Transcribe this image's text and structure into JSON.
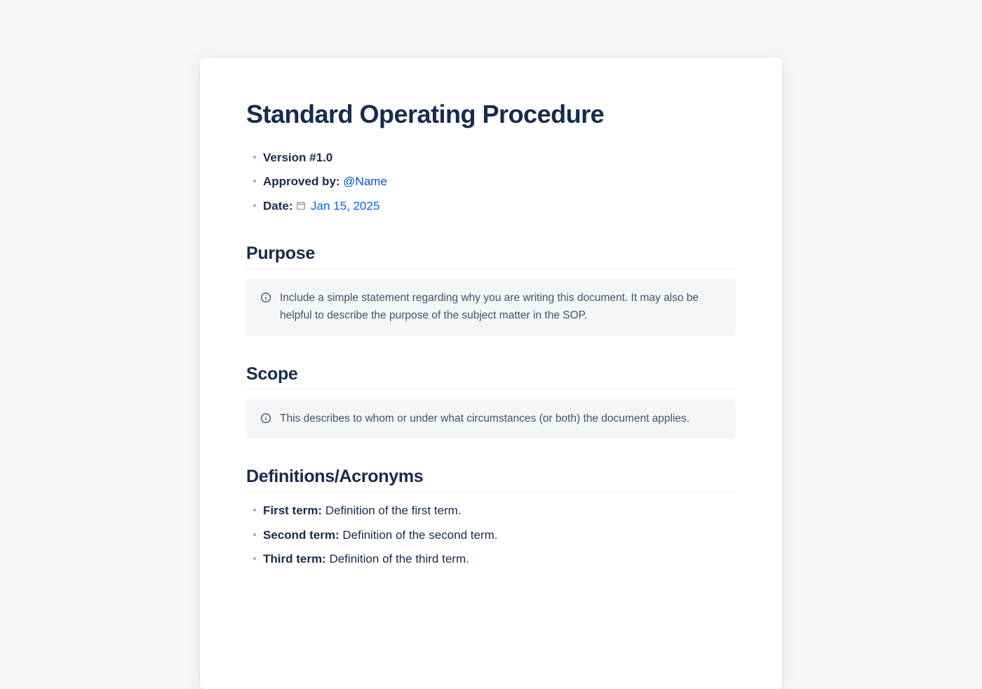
{
  "title": "Standard Operating Procedure",
  "meta": {
    "version_label": "Version #",
    "version_value": "1.0",
    "approved_label": "Approved by:",
    "approved_mention": "@Name",
    "date_label": "Date:",
    "date_value": "Jan 15, 2025"
  },
  "sections": {
    "purpose": {
      "heading": "Purpose",
      "panel": "Include a simple statement regarding why you are writing this document. It may also be helpful to describe the purpose of the subject matter in the SOP."
    },
    "scope": {
      "heading": "Scope",
      "panel": "This describes to whom or under what circumstances (or both) the document applies."
    },
    "definitions": {
      "heading": "Definitions/Acronyms",
      "items": [
        {
          "term": "First term:",
          "def": "Definition of the first term."
        },
        {
          "term": "Second term:",
          "def": "Definition of the second term."
        },
        {
          "term": "Third term:",
          "def": "Definition of the third term."
        }
      ]
    }
  }
}
